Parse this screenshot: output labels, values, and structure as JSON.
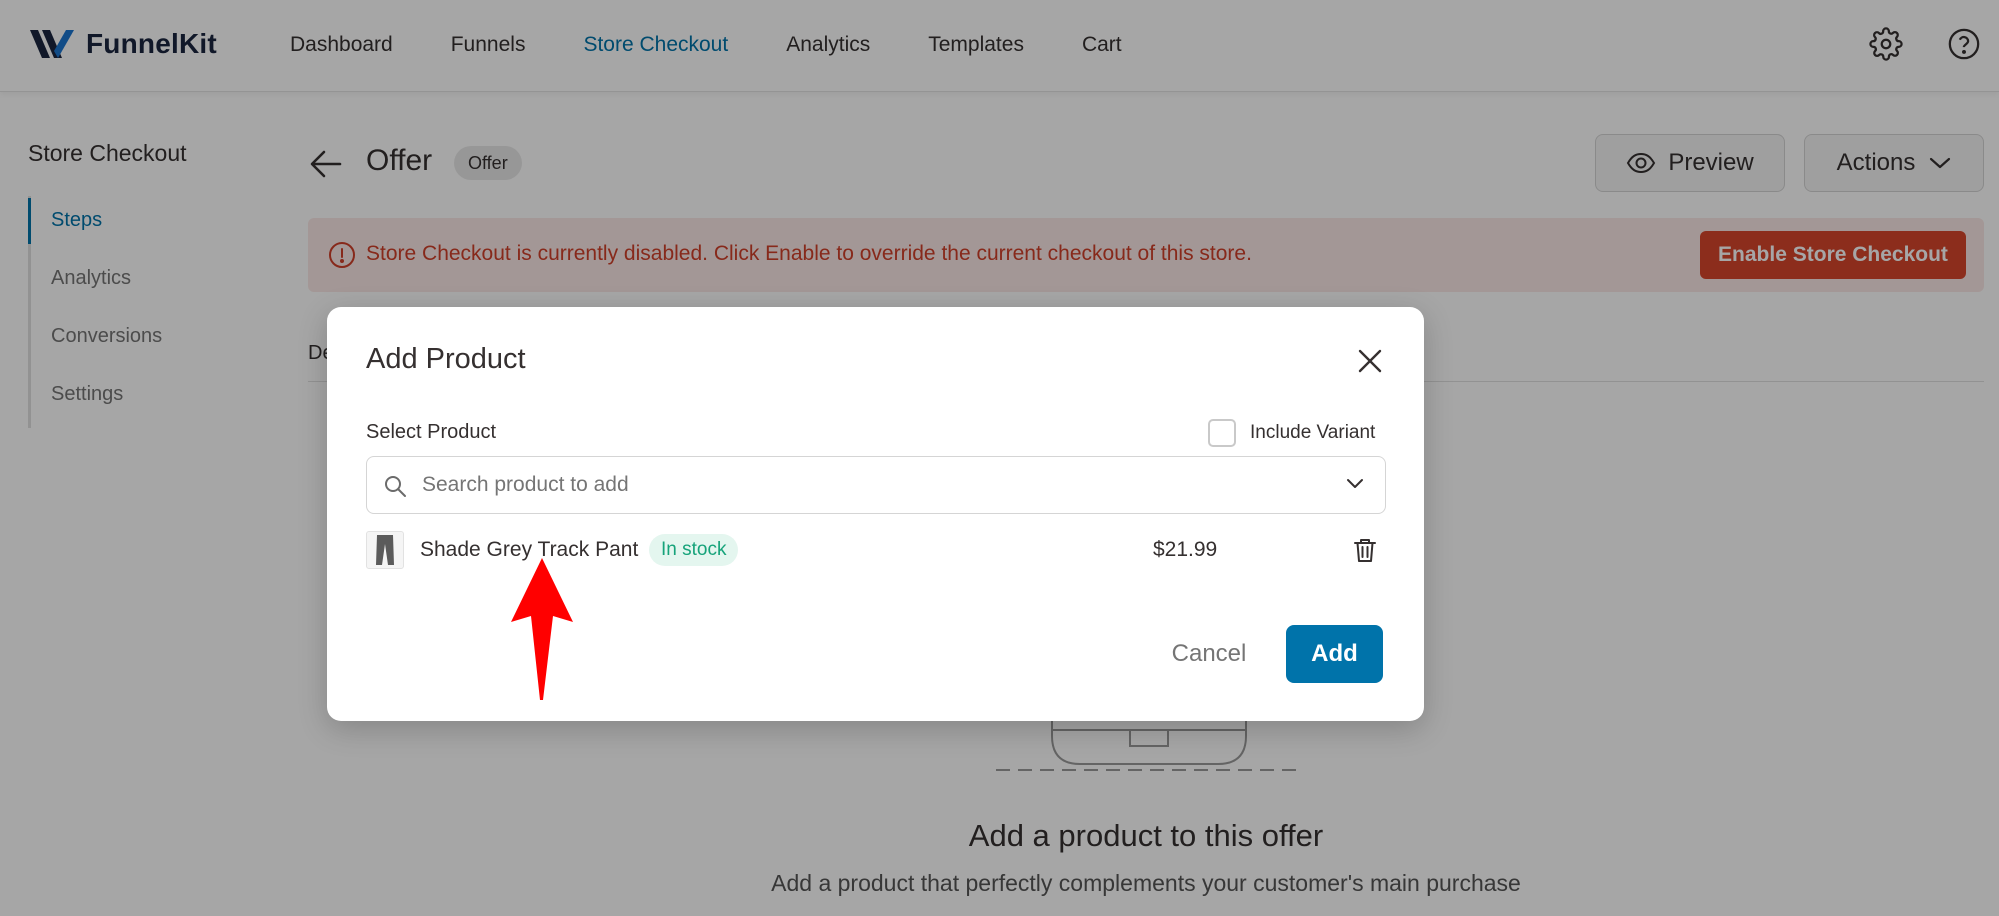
{
  "brand": {
    "logo_text": "FunnelKit",
    "logo_icon": "funnelkit-logo-icon"
  },
  "nav": {
    "items": [
      "Dashboard",
      "Funnels",
      "Store Checkout",
      "Analytics",
      "Templates",
      "Cart"
    ],
    "active": "Store Checkout",
    "icons": [
      "gear-icon",
      "help-icon"
    ]
  },
  "sidebar": {
    "title": "Store Checkout",
    "items": [
      {
        "label": "Steps",
        "active": true
      },
      {
        "label": "Analytics",
        "active": false
      },
      {
        "label": "Conversions",
        "active": false
      },
      {
        "label": "Settings",
        "active": false
      }
    ]
  },
  "header": {
    "title": "Offer",
    "badge": "Offer",
    "preview_label": "Preview",
    "actions_label": "Actions"
  },
  "alert": {
    "message": "Store Checkout is currently disabled. Click Enable to override the current checkout of this store.",
    "button_label": "Enable Store Checkout"
  },
  "tabs": {
    "partial_label": "De"
  },
  "empty_state": {
    "title": "Add a product to this offer",
    "subtitle": "Add a product that perfectly complements your customer's main purchase"
  },
  "modal": {
    "title": "Add Product",
    "select_label": "Select Product",
    "include_variant_label": "Include Variant",
    "include_variant_checked": false,
    "search_placeholder": "Search product to add",
    "search_value": "",
    "products": [
      {
        "name": "Shade Grey Track Pant",
        "stock": "In stock",
        "price": "$21.99"
      }
    ],
    "cancel_label": "Cancel",
    "add_label": "Add"
  },
  "colors": {
    "accent": "#0073aa",
    "alert_text": "#d0402a",
    "alert_button": "#d8452c",
    "stock_green": "#16a37a",
    "annotation_arrow": "#ff0000"
  }
}
